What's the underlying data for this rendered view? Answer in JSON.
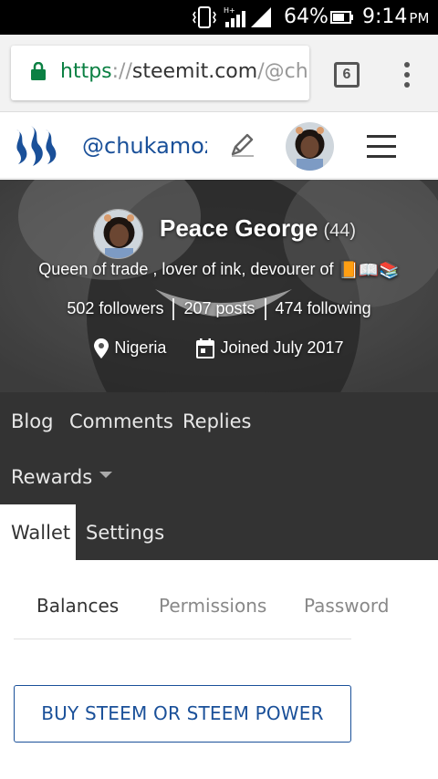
{
  "status_bar": {
    "battery_percent": "64%",
    "time": "9:14",
    "ampm": "PM",
    "network_label": "H+"
  },
  "browser": {
    "url_scheme": "https",
    "url_sep": "://",
    "url_host": "steemit.com",
    "url_path": "/@ch",
    "tab_count": "6"
  },
  "header": {
    "username": "@chukamoz",
    "brand_color": "#1a5099"
  },
  "profile": {
    "name": "Peace George",
    "reputation": "(44)",
    "bio": "Queen of trade , lover of ink, devourer of ",
    "bio_emoji": "📙📖📚",
    "followers": "502 followers",
    "posts": "207 posts",
    "following": "474 following",
    "location": "Nigeria",
    "joined": "Joined July 2017"
  },
  "nav": {
    "blog": "Blog",
    "comments": "Comments",
    "replies": "Replies",
    "rewards": "Rewards",
    "wallet": "Wallet",
    "settings": "Settings"
  },
  "wallet": {
    "tab_balances": "Balances",
    "tab_permissions": "Permissions",
    "tab_password": "Password",
    "buy_button": "BUY STEEM OR STEEM POWER"
  },
  "icons": {
    "lock": "lock-icon",
    "steemit_logo": "steemit-logo",
    "pencil": "pencil-icon",
    "menu": "hamburger-icon",
    "location": "map-pin-icon",
    "calendar": "calendar-icon"
  }
}
